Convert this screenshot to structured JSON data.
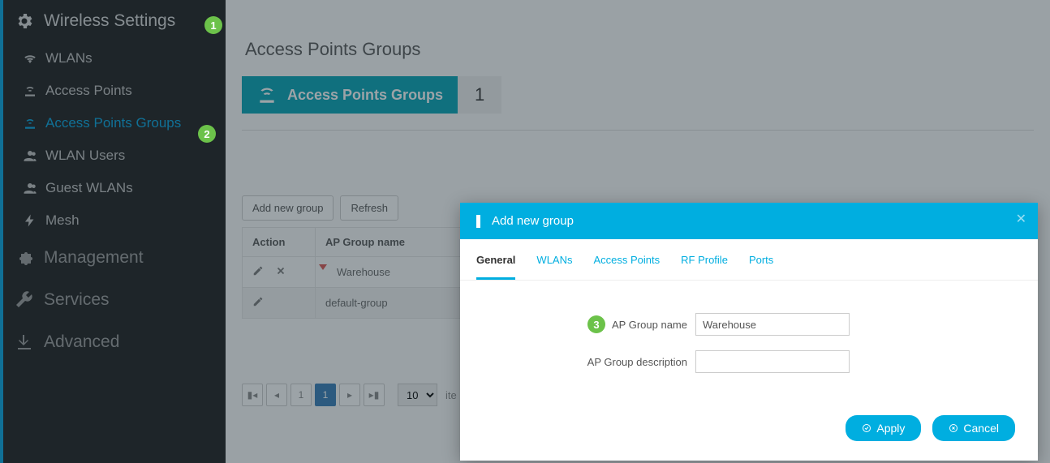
{
  "sidebar": {
    "wireless_settings": "Wireless Settings",
    "items": [
      {
        "label": "WLANs"
      },
      {
        "label": "Access Points"
      },
      {
        "label": "Access Points Groups"
      },
      {
        "label": "WLAN Users"
      },
      {
        "label": "Guest WLANs"
      },
      {
        "label": "Mesh"
      }
    ],
    "management": "Management",
    "services": "Services",
    "advanced": "Advanced"
  },
  "annotations": {
    "b1": "1",
    "b2": "2",
    "b3": "3"
  },
  "page": {
    "title": "Access Points Groups",
    "tile_label": "Access Points Groups",
    "tile_count": "1"
  },
  "toolbar": {
    "add": "Add new group",
    "refresh": "Refresh"
  },
  "table": {
    "col_action": "Action",
    "col_name": "AP Group name",
    "rows": [
      {
        "name": "Warehouse",
        "deletable": true,
        "dirty": true
      },
      {
        "name": "default-group",
        "deletable": false,
        "dirty": false
      }
    ]
  },
  "pager": {
    "page": "1",
    "total": "1",
    "size": "10",
    "items_label": "ite"
  },
  "modal": {
    "title": "Add new group",
    "tabs": [
      "General",
      "WLANs",
      "Access Points",
      "RF Profile",
      "Ports"
    ],
    "field_name_label": "AP Group name",
    "field_name_value": "Warehouse",
    "field_desc_label": "AP Group description",
    "field_desc_value": "",
    "apply": "Apply",
    "cancel": "Cancel"
  }
}
